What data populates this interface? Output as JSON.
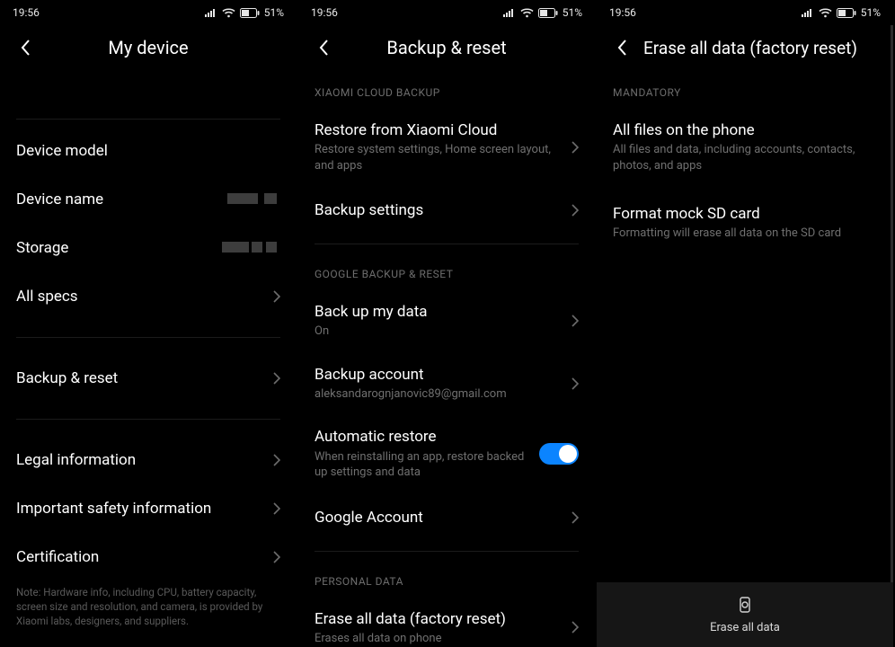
{
  "status": {
    "time": "19:56",
    "battery": "51%"
  },
  "p1": {
    "title": "My device",
    "rows": {
      "model": {
        "label": "Device model"
      },
      "name": {
        "label": "Device name"
      },
      "storage": {
        "label": "Storage"
      },
      "allspecs": {
        "label": "All specs"
      },
      "backup": {
        "label": "Backup & reset"
      },
      "legal": {
        "label": "Legal information"
      },
      "safety": {
        "label": "Important safety information"
      },
      "cert": {
        "label": "Certification"
      }
    },
    "note": "Note: Hardware info, including CPU, battery capacity, screen size and resolution, and camera, is provided by Xiaomi labs, designers, and suppliers."
  },
  "p2": {
    "title": "Backup & reset",
    "sections": {
      "xiaomi": "XIAOMI CLOUD BACKUP",
      "google": "GOOGLE BACKUP & RESET",
      "personal": "PERSONAL DATA"
    },
    "rows": {
      "restoreCloud": {
        "label": "Restore from Xiaomi Cloud",
        "sub": "Restore system settings, Home screen layout, and apps"
      },
      "backupSettings": {
        "label": "Backup settings"
      },
      "backupData": {
        "label": "Back up my data",
        "sub": "On"
      },
      "backupAccount": {
        "label": "Backup account",
        "sub": "aleksandarognjanovic89@gmail.com"
      },
      "autoRestore": {
        "label": "Automatic restore",
        "sub": "When reinstalling an app, restore backed up settings and data"
      },
      "googleAccount": {
        "label": "Google Account"
      },
      "eraseAll": {
        "label": "Erase all data (factory reset)",
        "sub": "Erases all data on phone"
      }
    }
  },
  "p3": {
    "title": "Erase all data (factory reset)",
    "sections": {
      "mandatory": "MANDATORY"
    },
    "rows": {
      "allFiles": {
        "label": "All files on the phone",
        "sub": "All files and data, including accounts, contacts, photos, and apps"
      },
      "formatSd": {
        "label": "Format mock SD card",
        "sub": "Formatting will erase all data on the SD card"
      }
    },
    "bottom": {
      "label": "Erase all data"
    }
  }
}
